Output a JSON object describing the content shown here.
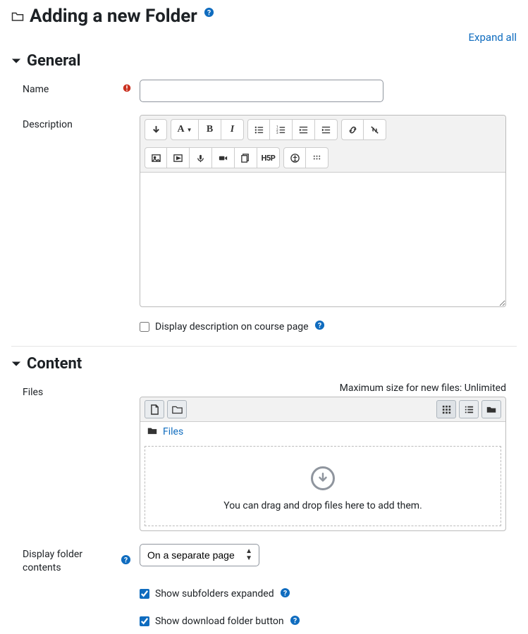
{
  "page": {
    "title": "Adding a new Folder",
    "expand_all": "Expand all"
  },
  "general": {
    "heading": "General",
    "name_label": "Name",
    "description_label": "Description",
    "display_desc_label": "Display description on course page"
  },
  "content": {
    "heading": "Content",
    "files_label": "Files",
    "max_size": "Maximum size for new files: Unlimited",
    "files_path_label": "Files",
    "drop_hint": "You can drag and drop files here to add them.",
    "display_folder_label": "Display folder contents",
    "display_folder_value": "On a separate page",
    "show_subfolders_label": "Show subfolders expanded",
    "show_download_label": "Show download folder button"
  },
  "editor_toolbar": {
    "expand": "↓",
    "paragraph": "A",
    "bold": "B",
    "italic": "I",
    "h5p": "H5P"
  }
}
